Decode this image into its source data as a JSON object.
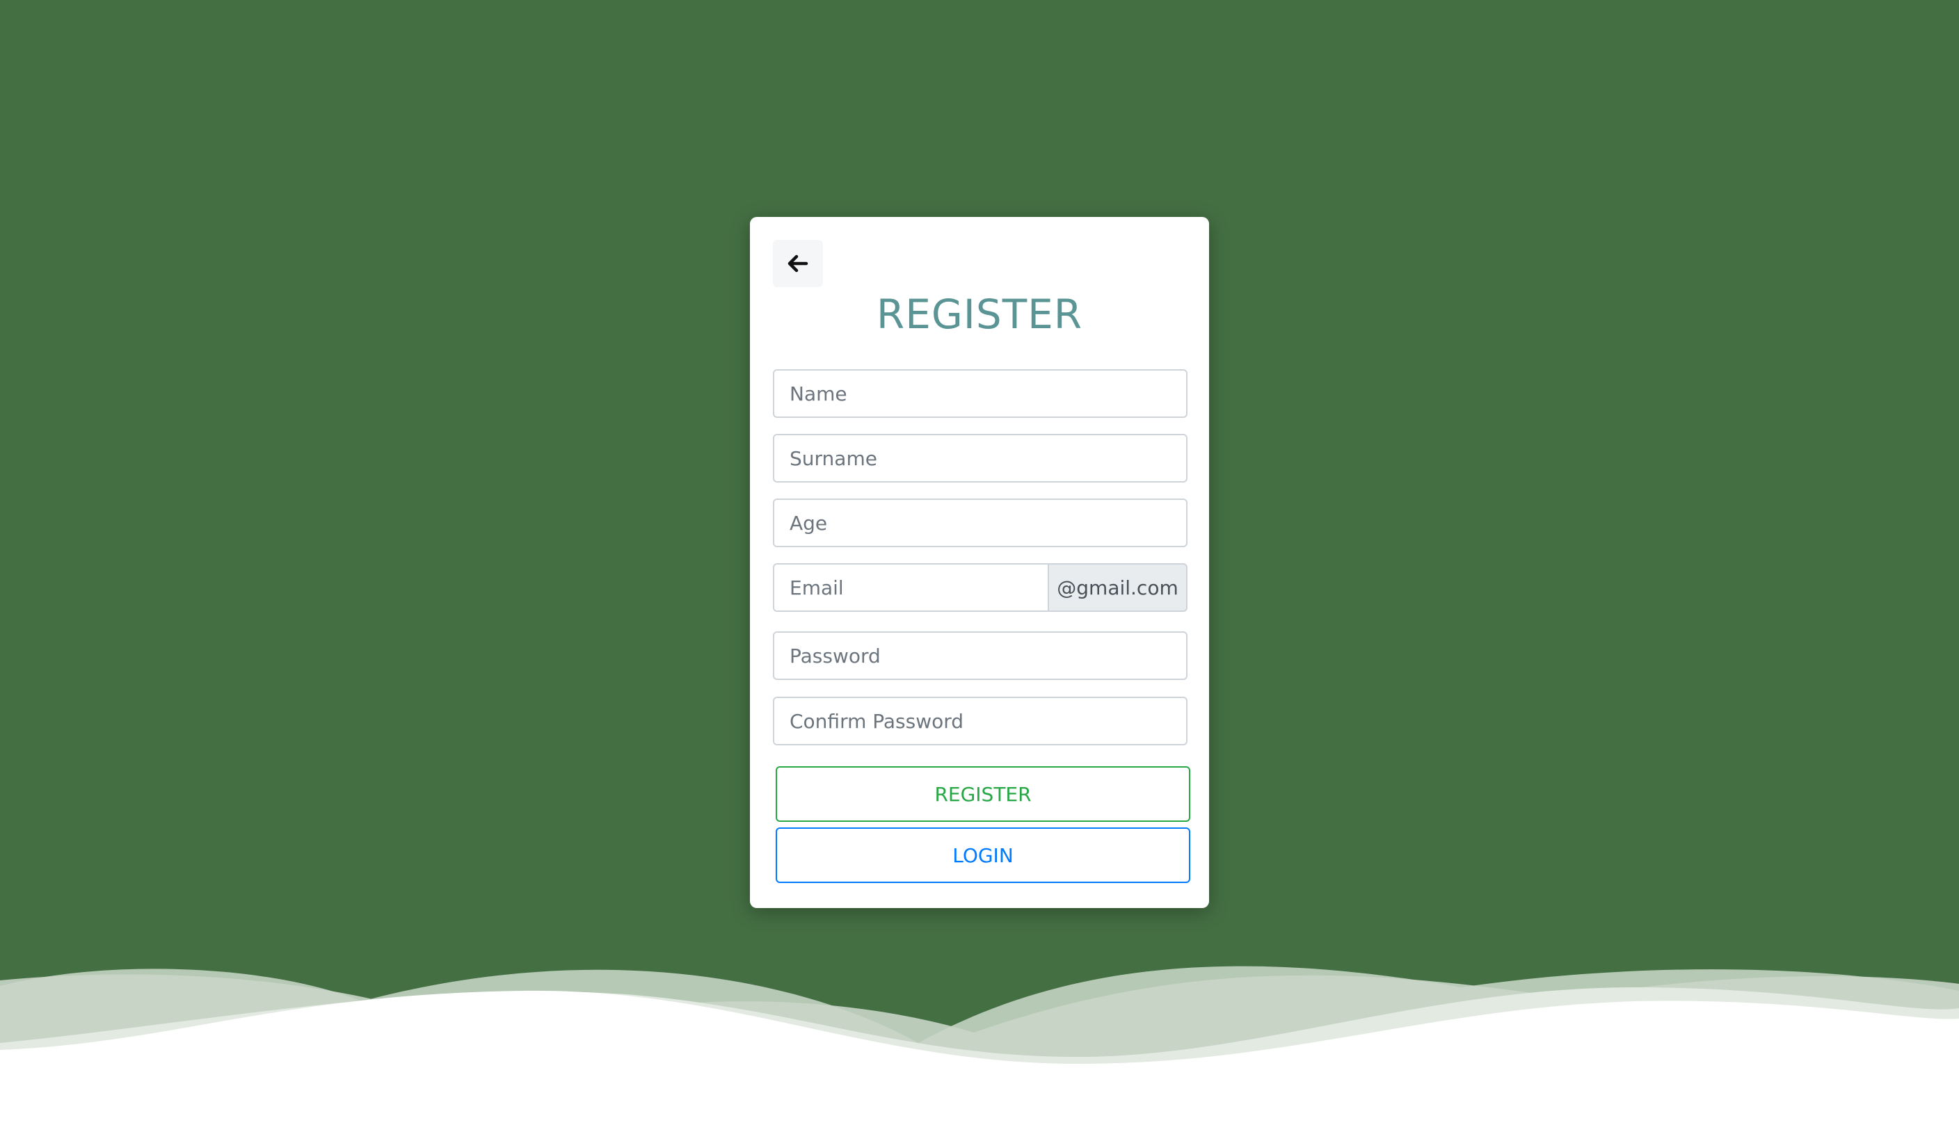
{
  "page": {
    "title": "REGISTER",
    "background_color": "#446f43",
    "accent_title_color": "#5a9494"
  },
  "header": {
    "back_icon": "arrow-left-icon"
  },
  "form": {
    "name_placeholder": "Name",
    "surname_placeholder": "Surname",
    "age_placeholder": "Age",
    "email_placeholder": "Email",
    "email_suffix": "@gmail.com",
    "password_placeholder": "Password",
    "confirm_password_placeholder": "Confirm Password"
  },
  "actions": {
    "register_label": "REGISTER",
    "register_color": "#28a745",
    "login_label": "LOGIN",
    "login_color": "#007bff"
  }
}
